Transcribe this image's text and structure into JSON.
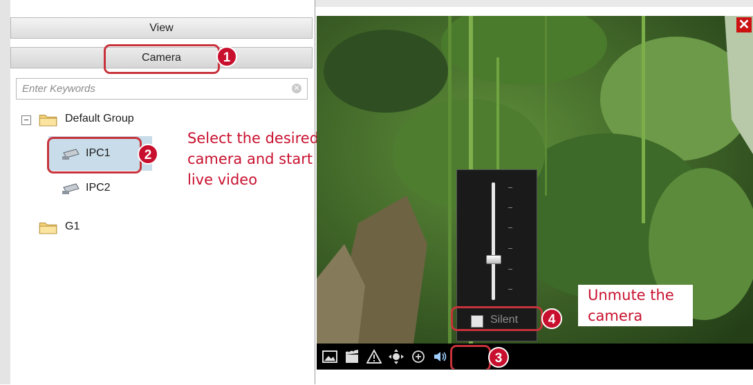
{
  "panel": {
    "view_header": "View",
    "camera_tab": "Camera",
    "search": {
      "placeholder": "Enter Keywords"
    },
    "tree": {
      "group": "Default Group",
      "cameras": [
        "IPC1",
        "IPC2"
      ],
      "folder2": "G1"
    }
  },
  "video": {
    "volume": {
      "level": 0.35,
      "silent_label": "Silent"
    }
  },
  "annotations": {
    "step1": "1",
    "step2": "2",
    "step3": "3",
    "step4": "4",
    "select_text": [
      "Select the desired",
      "camera and start",
      "live video"
    ],
    "unmute_text": [
      "Unmute the",
      "camera"
    ]
  },
  "colors": {
    "accent": "#c8102e",
    "selected_row": "#c8dcea"
  }
}
